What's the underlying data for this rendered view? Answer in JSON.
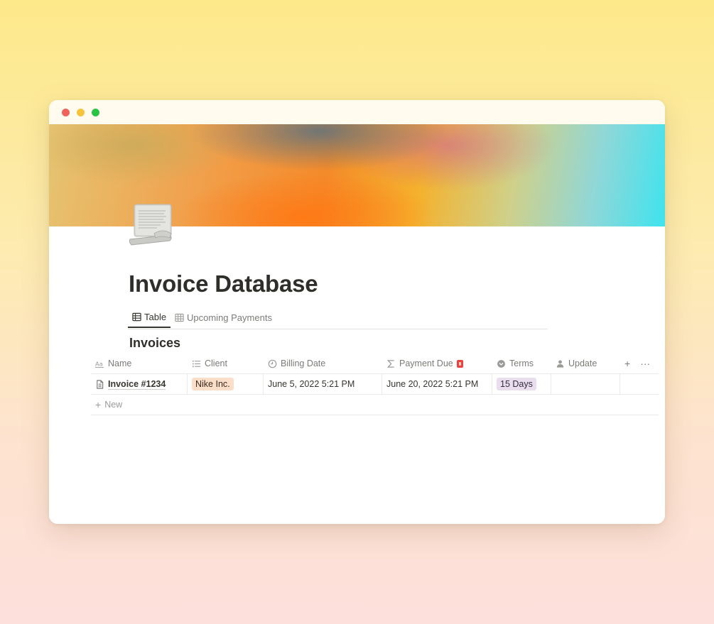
{
  "window": {
    "controls": [
      "close",
      "minimize",
      "maximize"
    ]
  },
  "page": {
    "icon": "scroll-page-icon",
    "title": "Invoice Database"
  },
  "views": {
    "tabs": [
      {
        "label": "Table",
        "icon": "table-icon",
        "active": true
      },
      {
        "label": "Upcoming Payments",
        "icon": "table-icon",
        "active": false
      }
    ]
  },
  "database": {
    "title": "Invoices",
    "columns": [
      {
        "label": "Name",
        "icon": "text-aa-icon"
      },
      {
        "label": "Client",
        "icon": "list-icon"
      },
      {
        "label": "Billing Date",
        "icon": "clock-icon"
      },
      {
        "label": "Payment Due",
        "icon": "sigma-icon",
        "emoji": "alarm-emoji"
      },
      {
        "label": "Terms",
        "icon": "select-chevron-icon"
      },
      {
        "label": "Update",
        "icon": "person-icon"
      }
    ],
    "rows": [
      {
        "name": "Invoice #1234",
        "client": "Nike Inc.",
        "billing_date": "June 5, 2022 5:21 PM",
        "payment_due": "June 20, 2022 5:21 PM",
        "terms": "15 Days",
        "update": ""
      }
    ],
    "new_label": "New",
    "add_icon": "+",
    "more_icon": "···"
  },
  "colors": {
    "client_pill": "#fadec9",
    "terms_pill": "#e8deee"
  }
}
